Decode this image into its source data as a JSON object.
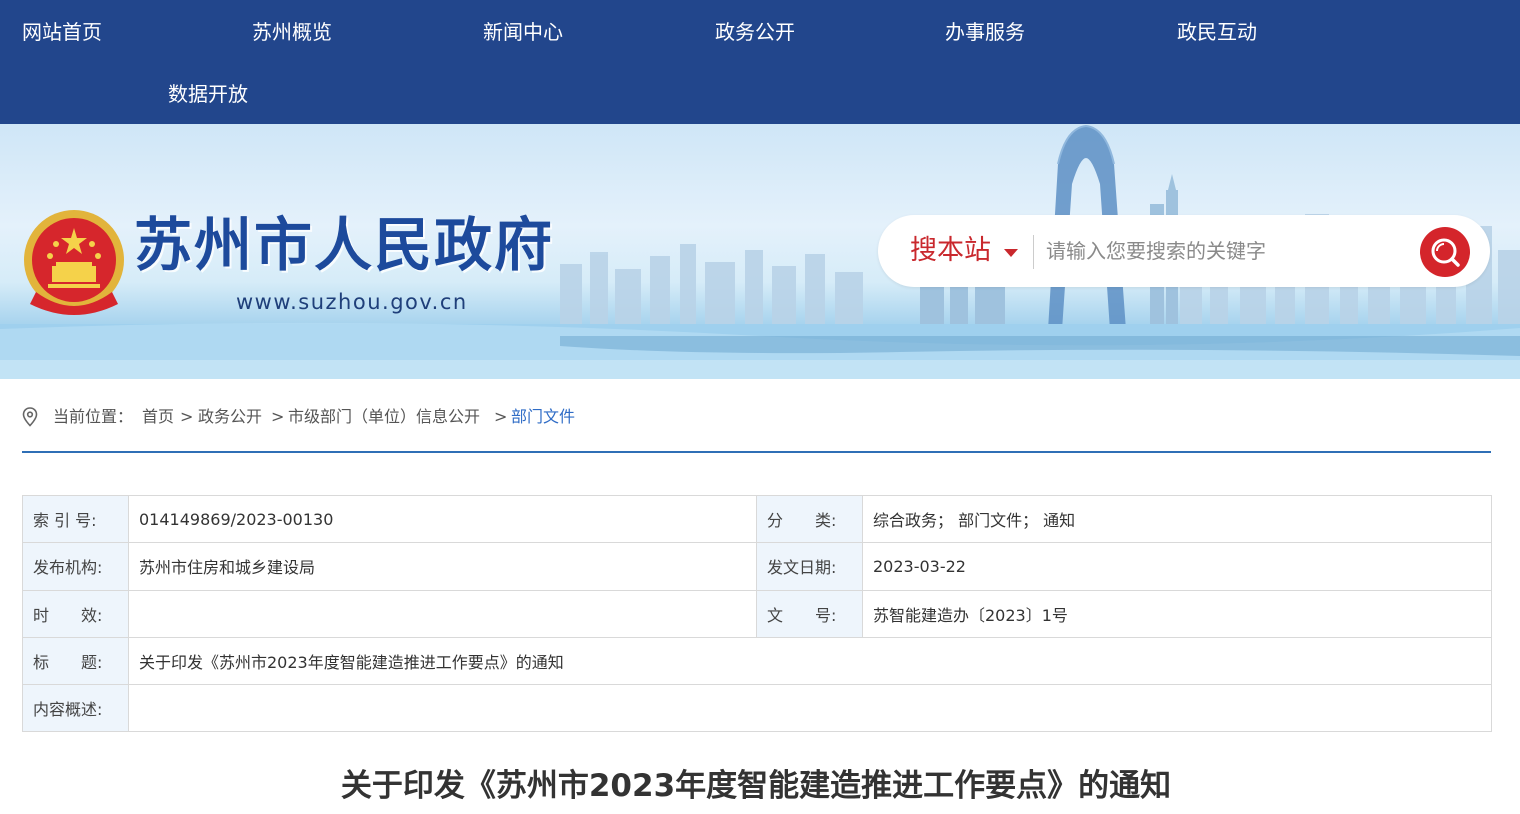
{
  "nav": {
    "items": [
      "网站首页",
      "苏州概览",
      "新闻中心",
      "政务公开",
      "办事服务",
      "政民互动",
      "数据开放"
    ]
  },
  "header": {
    "site_title": "苏州市人民政府",
    "site_url": "www.suzhou.gov.cn",
    "emblem_icon": "national-emblem-icon"
  },
  "search": {
    "scope_label": "搜本站",
    "placeholder": "请输入您要搜索的关键字",
    "button_icon": "search-icon"
  },
  "breadcrumb": {
    "prefix": "当前位置：",
    "items": [
      "首页",
      "政务公开",
      "市级部门（单位）信息公开",
      "部门文件"
    ],
    "separator": ">"
  },
  "info": {
    "index_label": "索 引 号:",
    "index_value": "014149869/2023-00130",
    "category_label": "分　　类:",
    "category_value": "综合政务； 部门文件； 通知",
    "publisher_label": "发布机构:",
    "publisher_value": "苏州市住房和城乡建设局",
    "date_label": "发文日期:",
    "date_value": "2023-03-22",
    "validity_label": "时　　效:",
    "validity_value": "",
    "docno_label": "文　　号:",
    "docno_value": "苏智能建造办〔2023〕1号",
    "title_label": "标　　题:",
    "title_value": "关于印发《苏州市2023年度智能建造推进工作要点》的通知",
    "summary_label": "内容概述:",
    "summary_value": ""
  },
  "document": {
    "title": "关于印发《苏州市2023年度智能建造推进工作要点》的通知"
  },
  "colors": {
    "nav_bg": "#22468c",
    "accent_red": "#c9282d",
    "link_blue": "#2f6cc6",
    "label_bg": "#eef5fc"
  }
}
